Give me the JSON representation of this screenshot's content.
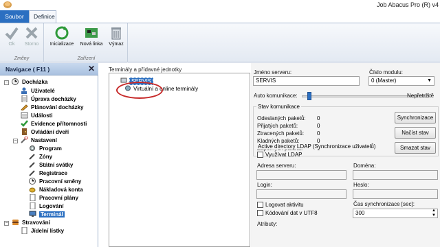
{
  "window": {
    "title": "Job Abacus Pro (R) v4"
  },
  "tabs": [
    {
      "label": "Soubor"
    },
    {
      "label": "Definice"
    }
  ],
  "ribbon": {
    "groups": [
      {
        "label": "Změny",
        "buttons": [
          {
            "label": "Ok"
          },
          {
            "label": "Storno"
          }
        ]
      },
      {
        "label": "Zařízení",
        "buttons": [
          {
            "label": "Inicializace"
          },
          {
            "label": "Nová linka"
          },
          {
            "label": "Výmaz"
          }
        ]
      }
    ]
  },
  "nav": {
    "title": "Navigace ( F11 )",
    "close_glyph": "✕",
    "items": [
      {
        "label": "Docházka"
      },
      {
        "label": "Uživatelé"
      },
      {
        "label": "Úprava docházky"
      },
      {
        "label": "Plánování docházky"
      },
      {
        "label": "Události"
      },
      {
        "label": "Evidence přítomnosti"
      },
      {
        "label": "Ovládání dveří"
      },
      {
        "label": "Nastavení"
      },
      {
        "label": "Program"
      },
      {
        "label": "Zóny"
      },
      {
        "label": "Státní svátky"
      },
      {
        "label": "Registrace"
      },
      {
        "label": "Pracovní směny"
      },
      {
        "label": "Nákladová konta"
      },
      {
        "label": "Pracovní plány"
      },
      {
        "label": "Logování"
      },
      {
        "label": "Terminál"
      },
      {
        "label": "Stravování"
      },
      {
        "label": "Jídelní lístky"
      }
    ]
  },
  "terminals": {
    "label": "Terminály a přídavné jednotky",
    "items": [
      {
        "label": "SERVIS"
      },
      {
        "label": "Virtuální a online terminály"
      }
    ]
  },
  "settings": {
    "server_name_label": "Jméno serveru:",
    "server_name_value": "SERVIS",
    "module_label": "Číslo modulu:",
    "module_value": "0 (Master)",
    "auto_comm_label": "Auto komunikace:",
    "auto_comm_end": "Nepřetržitě",
    "auto_comm_level": 0.06,
    "comm_status": {
      "title": "Stav komunikace",
      "rows": [
        {
          "label": "Odeslaných paketů:",
          "value": "0"
        },
        {
          "label": "Přijatých paketů:",
          "value": "0"
        },
        {
          "label": "Ztracených paketů:",
          "value": "0"
        },
        {
          "label": "Kladných paketů:",
          "value": "0"
        },
        {
          "label": "Záporných paketů:",
          "value": "0"
        }
      ],
      "buttons": [
        {
          "label": "Synchronizace"
        },
        {
          "label": "Načíst stav"
        },
        {
          "label": "Smazat stav"
        }
      ]
    },
    "ldap": {
      "title": "Active directory LDAP (Synchronizace uživatelů)",
      "use_label": "Využívat LDAP",
      "server_address_label": "Adresa serveru:",
      "domain_label": "Doména:",
      "login_label": "Login:",
      "password_label": "Heslo:",
      "log_activity_label": "Logovat aktivitu",
      "utf8_label": "Kódování dat v UTF8",
      "sync_time_label": "Čas synchronizace [sec]:",
      "sync_time_value": "300",
      "attributes_label": "Atributy:"
    }
  }
}
